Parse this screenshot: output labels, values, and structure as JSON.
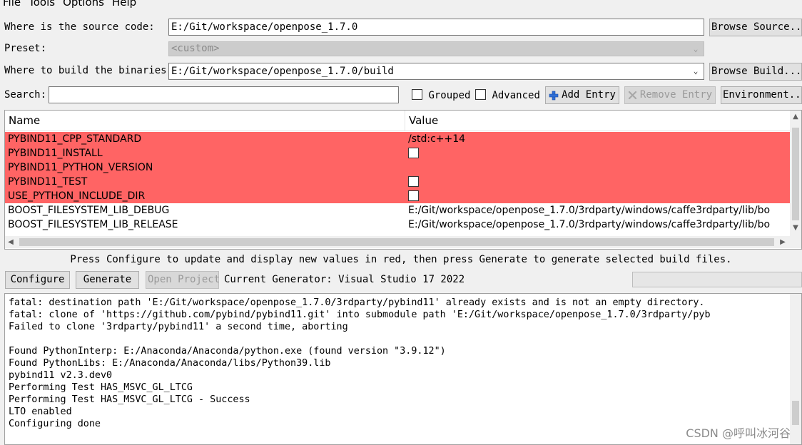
{
  "menu": [
    "File",
    "Tools",
    "Options",
    "Help"
  ],
  "source": {
    "label": "Where is the source code:",
    "value": "E:/Git/workspace/openpose_1.7.0",
    "browse_label": "Browse Source..."
  },
  "preset": {
    "label": "Preset:",
    "value": "<custom>"
  },
  "build": {
    "label": "Where to build the binaries:",
    "value": "E:/Git/workspace/openpose_1.7.0/build",
    "browse_label": "Browse Build..."
  },
  "search": {
    "label": "Search:",
    "value": ""
  },
  "toolbar": {
    "grouped_label": "Grouped",
    "advanced_label": "Advanced",
    "add_entry_label": "Add Entry",
    "remove_entry_label": "Remove Entry",
    "environment_label": "Environment..."
  },
  "table": {
    "headers": [
      "Name",
      "Value"
    ],
    "rows": [
      {
        "name": "PYBIND11_CPP_STANDARD",
        "value": "/std:c++14",
        "type": "text",
        "new": true
      },
      {
        "name": "PYBIND11_INSTALL",
        "value": "",
        "type": "bool",
        "new": true
      },
      {
        "name": "PYBIND11_PYTHON_VERSION",
        "value": "",
        "type": "text",
        "new": true
      },
      {
        "name": "PYBIND11_TEST",
        "value": "",
        "type": "bool",
        "new": true
      },
      {
        "name": "USE_PYTHON_INCLUDE_DIR",
        "value": "",
        "type": "bool",
        "new": true
      },
      {
        "name": "BOOST_FILESYSTEM_LIB_DEBUG",
        "value": "E:/Git/workspace/openpose_1.7.0/3rdparty/windows/caffe3rdparty/lib/bo",
        "type": "text",
        "new": false
      },
      {
        "name": "BOOST_FILESYSTEM_LIB_RELEASE",
        "value": "E:/Git/workspace/openpose_1.7.0/3rdparty/windows/caffe3rdparty/lib/bo",
        "type": "text",
        "new": false
      }
    ]
  },
  "hint_text": "Press Configure to update and display new values in red, then press Generate to generate selected build files.",
  "actions": {
    "configure_label": "Configure",
    "generate_label": "Generate",
    "open_project_label": "Open Project",
    "generator_text": "Current Generator: Visual Studio 17 2022"
  },
  "log_lines": [
    "fatal: destination path 'E:/Git/workspace/openpose_1.7.0/3rdparty/pybind11' already exists and is not an empty directory.",
    "fatal: clone of 'https://github.com/pybind/pybind11.git' into submodule path 'E:/Git/workspace/openpose_1.7.0/3rdparty/pyb",
    "Failed to clone '3rdparty/pybind11' a second time, aborting",
    "",
    "Found PythonInterp: E:/Anaconda/Anaconda/python.exe (found version \"3.9.12\")",
    "Found PythonLibs: E:/Anaconda/Anaconda/libs/Python39.lib",
    "pybind11 v2.3.dev0",
    "Performing Test HAS_MSVC_GL_LTCG",
    "Performing Test HAS_MSVC_GL_LTCG - Success",
    "LTO enabled",
    "Configuring done"
  ],
  "watermark": "CSDN @呼叫冰河谷",
  "colors": {
    "new_entry_bg": "#ff6464",
    "window_bg": "#f0f0f0"
  }
}
